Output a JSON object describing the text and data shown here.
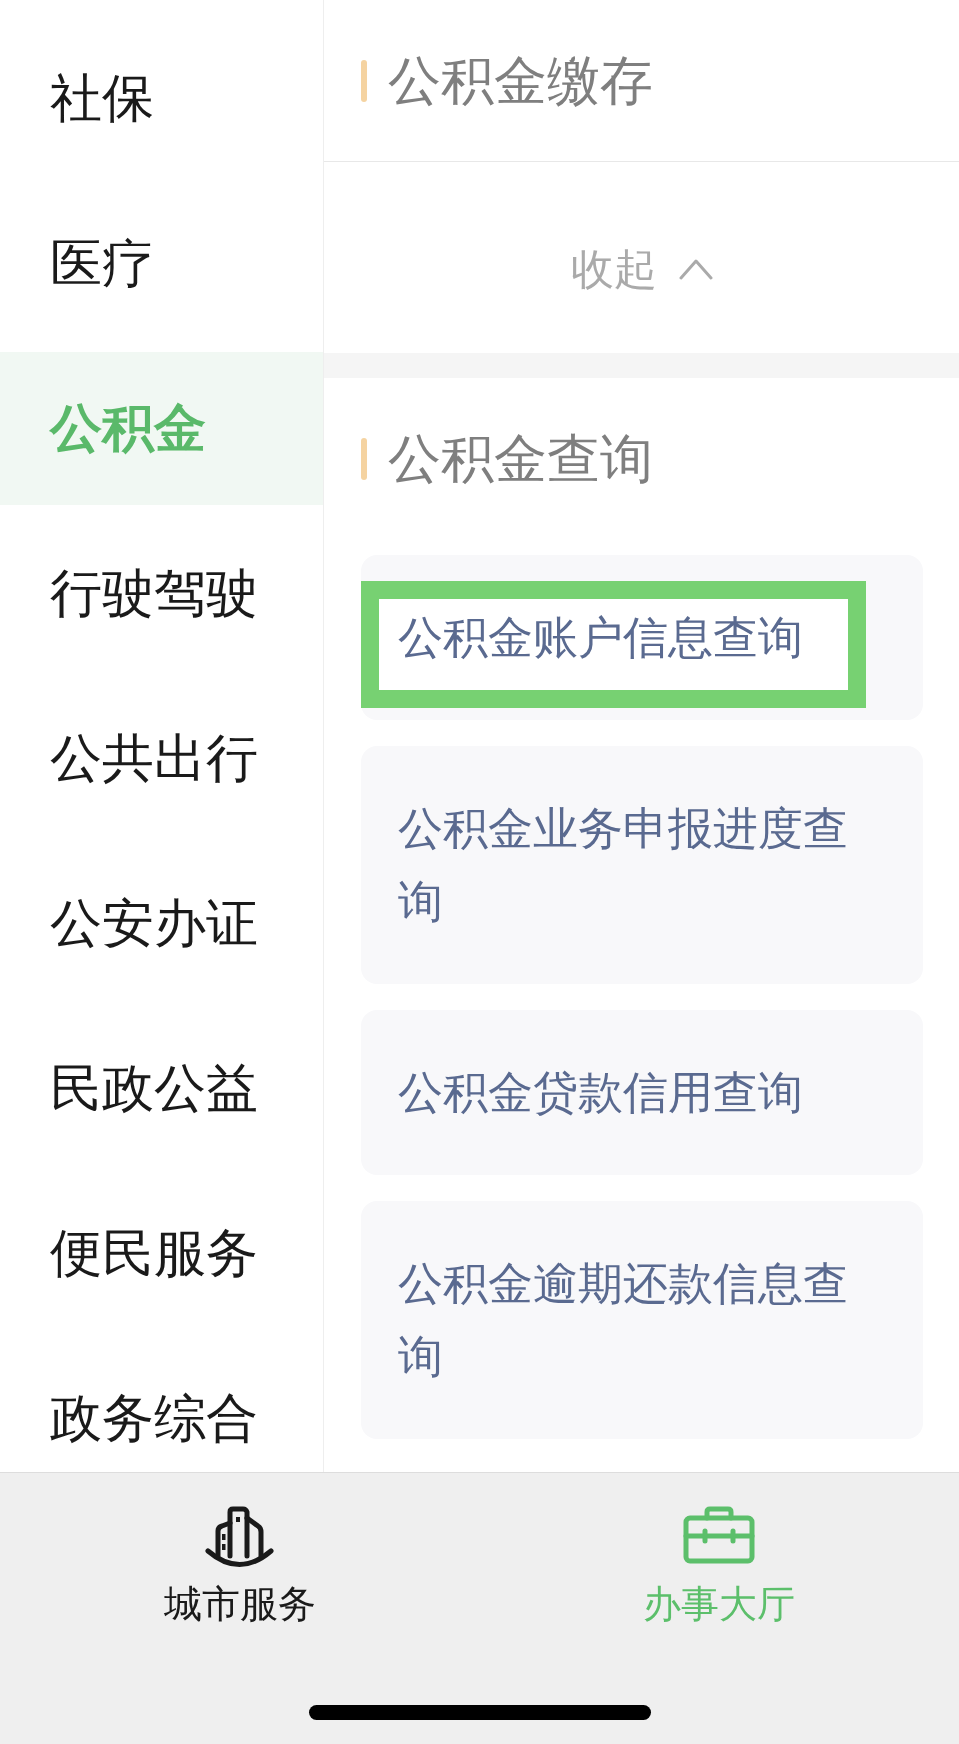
{
  "sidebar": {
    "items": [
      {
        "label": "社保",
        "selected": false
      },
      {
        "label": "医疗",
        "selected": false
      },
      {
        "label": "公积金",
        "selected": true
      },
      {
        "label": "行驶驾驶",
        "selected": false
      },
      {
        "label": "公共出行",
        "selected": false
      },
      {
        "label": "公安办证",
        "selected": false
      },
      {
        "label": "民政公益",
        "selected": false
      },
      {
        "label": "便民服务",
        "selected": false
      },
      {
        "label": "政务综合",
        "selected": false
      }
    ]
  },
  "sections": [
    {
      "title": "公积金缴存",
      "toggle": {
        "label": "收起",
        "expanded": true
      }
    },
    {
      "title": "公积金查询",
      "items": [
        {
          "label": "公积金账户信息查询",
          "highlighted": true
        },
        {
          "label": "公积金业务申报进度查询",
          "highlighted": false
        },
        {
          "label": "公积金贷款信用查询",
          "highlighted": false
        },
        {
          "label": "公积金逾期还款信息查询",
          "highlighted": false
        }
      ]
    }
  ],
  "tab_bar": {
    "tabs": [
      {
        "label": "城市服务",
        "selected": false
      },
      {
        "label": "办事大厅",
        "selected": true
      }
    ]
  }
}
